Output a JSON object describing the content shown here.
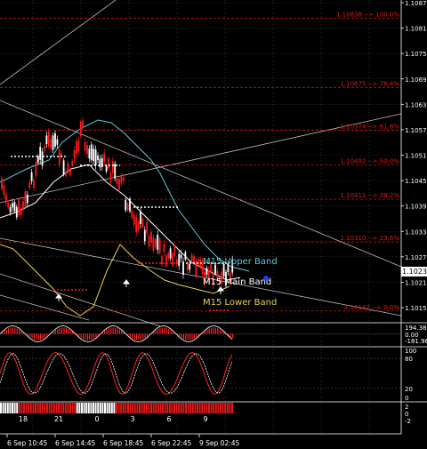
{
  "colors": {
    "background": "#000000",
    "grid": "#444444",
    "candle_bull": "#ffffff",
    "candle_bear": "#ff1a1a",
    "fib": "#e01818",
    "upper_band": "#5ec8d8",
    "main_band": "#ffffff",
    "lower_band": "#e8d24a",
    "trend_lines": "#bbbbbb",
    "stoch_main": "#ff2222",
    "stoch_signal": "#ffffff",
    "cci_line": "#ffffff",
    "cci_hist": "#ff2222",
    "session_red": "#e01818",
    "axis_text": "#ffffff"
  },
  "main_price_axis": {
    "ticks": [
      "1.10875",
      "1.10815",
      "1.10755",
      "1.10695",
      "1.10635",
      "1.10575",
      "1.10515",
      "1.10455",
      "1.10395",
      "1.10335",
      "1.10275",
      "1.10215",
      "1.10155"
    ],
    "current_price": "1.10238"
  },
  "fib_levels": [
    {
      "price": "1.10838",
      "pct": "100.0%",
      "label": "1.10838 --> 100.0%"
    },
    {
      "price": "1.10675",
      "pct": "76.4%",
      "label": "1.10675 --> 76.4%"
    },
    {
      "price": "1.10574",
      "pct": "61.8%",
      "label": "1.10574 --> 61.8%"
    },
    {
      "price": "1.10492",
      "pct": "50.0%",
      "label": "1.10492 --> 50.0%"
    },
    {
      "price": "1.10411",
      "pct": "38.2%",
      "label": "1.10411 --> 38.2%"
    },
    {
      "price": "1.10310",
      "pct": "23.6%",
      "label": "1.10310 --> 23.6%"
    },
    {
      "price": "1.10147",
      "pct": "0.0%",
      "label": "1.10147 --> 0.0%"
    }
  ],
  "band_labels": {
    "upper": "M15 Upper Band",
    "main": "M15 Main Band",
    "lower": "M15 Lower Band"
  },
  "cci_axis": {
    "top": "194.389",
    "zero": "0.00",
    "bottom": "-181.966"
  },
  "stoch_axis": {
    "high": "100",
    "mid_high": "80",
    "mid_low": "20",
    "low": "0"
  },
  "session_axis": {
    "labels": [
      "2",
      "0",
      "-2"
    ]
  },
  "session_hours": [
    "18",
    "21",
    "0",
    "3",
    "6",
    "9"
  ],
  "time_labels": [
    "6 Sep 10:45",
    "6 Sep 14:45",
    "6 Sep 18:45",
    "6 Sep 22:45",
    "9 Sep 02:45"
  ]
}
